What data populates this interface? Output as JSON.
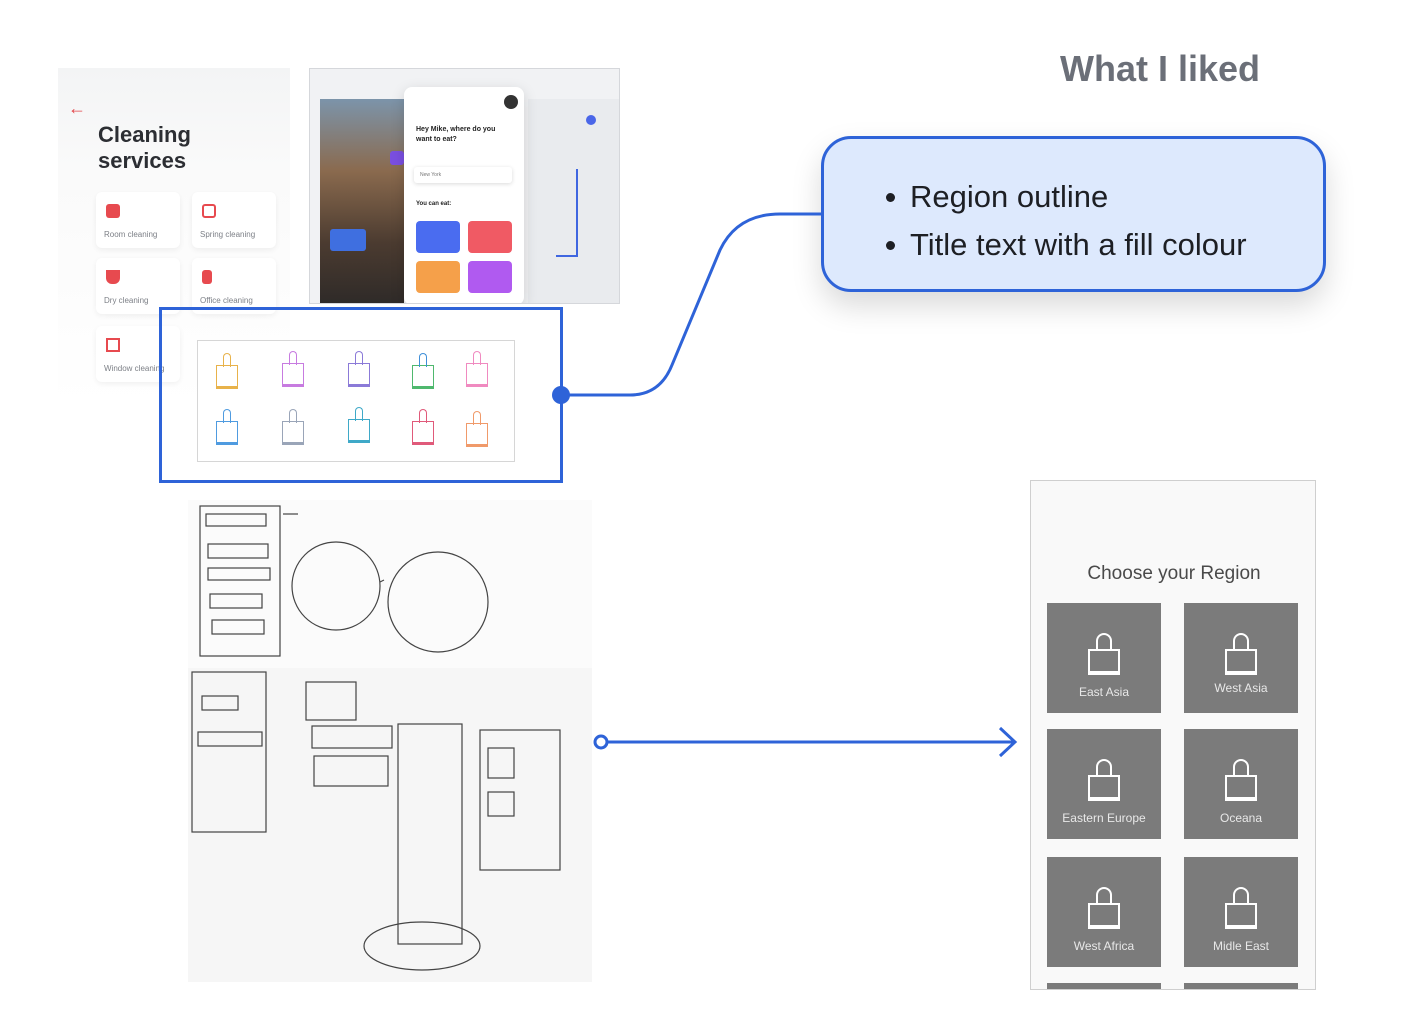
{
  "heading": "What I liked",
  "callout": {
    "items": [
      "Region outline",
      "Title text with a fill colour"
    ]
  },
  "cleaning": {
    "back_icon": "arrow-left-icon",
    "title": "Cleaning services",
    "services": [
      "Room cleaning",
      "Spring cleaning",
      "Dry cleaning",
      "Office cleaning",
      "Window cleaning"
    ],
    "accent": "#e74a4f"
  },
  "travel": {
    "greeting": "Hey Mike, where do you want to eat?",
    "search_value": "New York",
    "can_eat_label": "You can eat:",
    "tile_colors": [
      "#4a6cf0",
      "#f05a64",
      "#f5a04a",
      "#b05af0"
    ]
  },
  "region_screen": {
    "title": "Choose your Region",
    "regions": [
      "East Asia",
      "West Asia",
      "Eastern Europe",
      "Oceana",
      "West Africa",
      "Midle East"
    ]
  },
  "colors": {
    "accent": "#2e63d8",
    "callout_fill": "#dde9fd",
    "heading": "#6b6f78",
    "tile": "#7b7b7b"
  }
}
